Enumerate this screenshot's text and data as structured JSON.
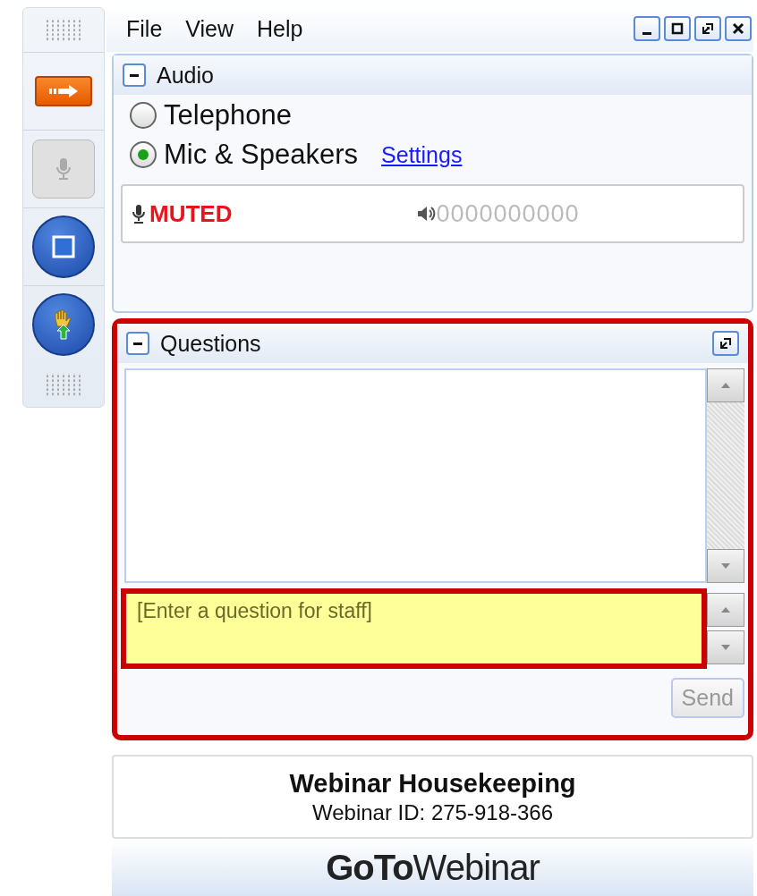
{
  "toolbar": {
    "buttons": [
      {
        "kind": "arrow"
      },
      {
        "kind": "mic",
        "disabled": true
      },
      {
        "kind": "screen"
      },
      {
        "kind": "hand"
      }
    ]
  },
  "menu": [
    "File",
    "View",
    "Help"
  ],
  "audio": {
    "title": "Audio",
    "options": [
      {
        "label": "Telephone",
        "selected": false
      },
      {
        "label": "Mic & Speakers",
        "selected": true
      }
    ],
    "settings_link": "Settings",
    "status": "MUTED",
    "meter": "0000000000"
  },
  "questions": {
    "title": "Questions",
    "highlighted": true,
    "input": {
      "placeholder": "[Enter a question for staff]",
      "highlighted": true
    },
    "send": {
      "label": "Send",
      "disabled": true
    }
  },
  "info": {
    "title": "Webinar Housekeeping",
    "id": "Webinar ID: 275-918-366"
  },
  "logo": "**GoTo**Webinar"
}
